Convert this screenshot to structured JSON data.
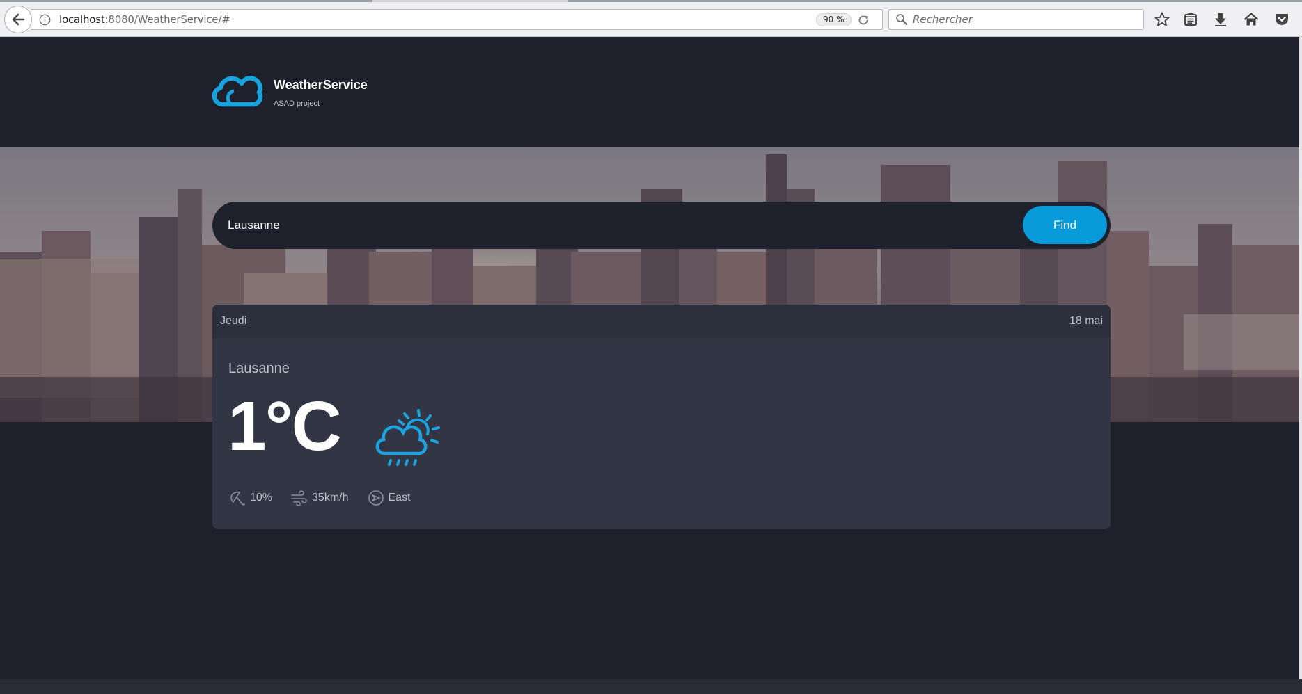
{
  "browser": {
    "url_host": "localhost",
    "url_rest": ":8080/WeatherService/#",
    "zoom": "90 %",
    "search_placeholder": "Rechercher",
    "toolbar_icons": [
      "star-icon",
      "reading-list-icon",
      "download-icon",
      "home-icon",
      "pocket-icon"
    ]
  },
  "brand": {
    "title": "WeatherService",
    "subtitle": "ASAD project"
  },
  "search": {
    "value": "Lausanne",
    "button_label": "Find"
  },
  "forecast": {
    "day": "Jeudi",
    "date": "18 mai",
    "city": "Lausanne",
    "temperature": "1",
    "unit": "°C",
    "condition_icon": "cloud-sun-rain-icon",
    "stats": [
      {
        "icon": "umbrella-icon",
        "value": "10%"
      },
      {
        "icon": "wind-icon",
        "value": "35km/h"
      },
      {
        "icon": "compass-icon",
        "value": "East"
      }
    ]
  },
  "colors": {
    "background": "#1e202c",
    "card": "#323544",
    "card_header": "#2c2f3c",
    "accent": "#099ad9",
    "icon_blue": "#1da3df"
  }
}
